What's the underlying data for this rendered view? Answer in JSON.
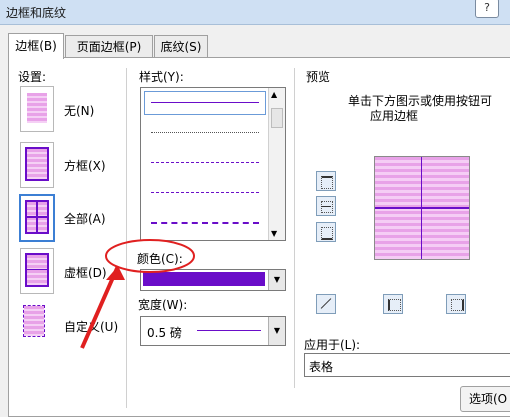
{
  "window": {
    "title": "边框和底纹",
    "help": "?"
  },
  "tabs": [
    {
      "label": "边框(B)"
    },
    {
      "label": "页面边框(P)"
    },
    {
      "label": "底纹(S)"
    }
  ],
  "settings": {
    "heading": "设置:",
    "items": [
      {
        "label": "无(N)"
      },
      {
        "label": "方框(X)"
      },
      {
        "label": "全部(A)"
      },
      {
        "label": "虚框(D)"
      },
      {
        "label": "自定义(U)"
      }
    ]
  },
  "style": {
    "heading": "样式(Y):"
  },
  "color": {
    "heading": "颜色(C):",
    "value_hex": "#6a0dc9"
  },
  "width": {
    "heading": "宽度(W):",
    "value": "0.5 磅"
  },
  "preview": {
    "heading": "预览",
    "hint_line1": "单击下方图示或使用按钮可",
    "hint_line2": "应用边框"
  },
  "apply_to": {
    "heading": "应用于(L):",
    "value": "表格"
  },
  "options_button": {
    "label": "选项(O"
  },
  "colors": {
    "line": "#6a0dc9",
    "arrow": "#e02020"
  }
}
